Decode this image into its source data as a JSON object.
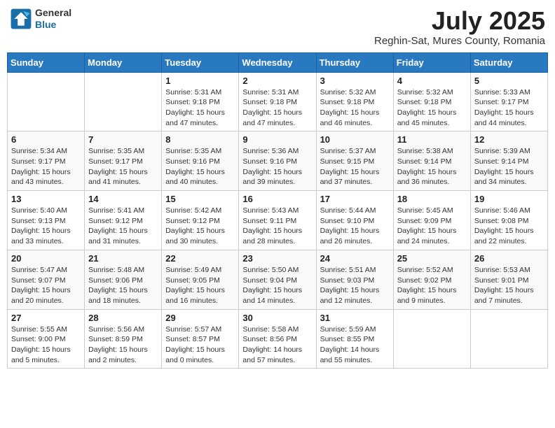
{
  "header": {
    "logo_line1": "General",
    "logo_line2": "Blue",
    "month": "July 2025",
    "location": "Reghin-Sat, Mures County, Romania"
  },
  "weekdays": [
    "Sunday",
    "Monday",
    "Tuesday",
    "Wednesday",
    "Thursday",
    "Friday",
    "Saturday"
  ],
  "weeks": [
    [
      {
        "day": "",
        "sunrise": "",
        "sunset": "",
        "daylight": ""
      },
      {
        "day": "",
        "sunrise": "",
        "sunset": "",
        "daylight": ""
      },
      {
        "day": "1",
        "sunrise": "Sunrise: 5:31 AM",
        "sunset": "Sunset: 9:18 PM",
        "daylight": "Daylight: 15 hours and 47 minutes."
      },
      {
        "day": "2",
        "sunrise": "Sunrise: 5:31 AM",
        "sunset": "Sunset: 9:18 PM",
        "daylight": "Daylight: 15 hours and 47 minutes."
      },
      {
        "day": "3",
        "sunrise": "Sunrise: 5:32 AM",
        "sunset": "Sunset: 9:18 PM",
        "daylight": "Daylight: 15 hours and 46 minutes."
      },
      {
        "day": "4",
        "sunrise": "Sunrise: 5:32 AM",
        "sunset": "Sunset: 9:18 PM",
        "daylight": "Daylight: 15 hours and 45 minutes."
      },
      {
        "day": "5",
        "sunrise": "Sunrise: 5:33 AM",
        "sunset": "Sunset: 9:17 PM",
        "daylight": "Daylight: 15 hours and 44 minutes."
      }
    ],
    [
      {
        "day": "6",
        "sunrise": "Sunrise: 5:34 AM",
        "sunset": "Sunset: 9:17 PM",
        "daylight": "Daylight: 15 hours and 43 minutes."
      },
      {
        "day": "7",
        "sunrise": "Sunrise: 5:35 AM",
        "sunset": "Sunset: 9:17 PM",
        "daylight": "Daylight: 15 hours and 41 minutes."
      },
      {
        "day": "8",
        "sunrise": "Sunrise: 5:35 AM",
        "sunset": "Sunset: 9:16 PM",
        "daylight": "Daylight: 15 hours and 40 minutes."
      },
      {
        "day": "9",
        "sunrise": "Sunrise: 5:36 AM",
        "sunset": "Sunset: 9:16 PM",
        "daylight": "Daylight: 15 hours and 39 minutes."
      },
      {
        "day": "10",
        "sunrise": "Sunrise: 5:37 AM",
        "sunset": "Sunset: 9:15 PM",
        "daylight": "Daylight: 15 hours and 37 minutes."
      },
      {
        "day": "11",
        "sunrise": "Sunrise: 5:38 AM",
        "sunset": "Sunset: 9:14 PM",
        "daylight": "Daylight: 15 hours and 36 minutes."
      },
      {
        "day": "12",
        "sunrise": "Sunrise: 5:39 AM",
        "sunset": "Sunset: 9:14 PM",
        "daylight": "Daylight: 15 hours and 34 minutes."
      }
    ],
    [
      {
        "day": "13",
        "sunrise": "Sunrise: 5:40 AM",
        "sunset": "Sunset: 9:13 PM",
        "daylight": "Daylight: 15 hours and 33 minutes."
      },
      {
        "day": "14",
        "sunrise": "Sunrise: 5:41 AM",
        "sunset": "Sunset: 9:12 PM",
        "daylight": "Daylight: 15 hours and 31 minutes."
      },
      {
        "day": "15",
        "sunrise": "Sunrise: 5:42 AM",
        "sunset": "Sunset: 9:12 PM",
        "daylight": "Daylight: 15 hours and 30 minutes."
      },
      {
        "day": "16",
        "sunrise": "Sunrise: 5:43 AM",
        "sunset": "Sunset: 9:11 PM",
        "daylight": "Daylight: 15 hours and 28 minutes."
      },
      {
        "day": "17",
        "sunrise": "Sunrise: 5:44 AM",
        "sunset": "Sunset: 9:10 PM",
        "daylight": "Daylight: 15 hours and 26 minutes."
      },
      {
        "day": "18",
        "sunrise": "Sunrise: 5:45 AM",
        "sunset": "Sunset: 9:09 PM",
        "daylight": "Daylight: 15 hours and 24 minutes."
      },
      {
        "day": "19",
        "sunrise": "Sunrise: 5:46 AM",
        "sunset": "Sunset: 9:08 PM",
        "daylight": "Daylight: 15 hours and 22 minutes."
      }
    ],
    [
      {
        "day": "20",
        "sunrise": "Sunrise: 5:47 AM",
        "sunset": "Sunset: 9:07 PM",
        "daylight": "Daylight: 15 hours and 20 minutes."
      },
      {
        "day": "21",
        "sunrise": "Sunrise: 5:48 AM",
        "sunset": "Sunset: 9:06 PM",
        "daylight": "Daylight: 15 hours and 18 minutes."
      },
      {
        "day": "22",
        "sunrise": "Sunrise: 5:49 AM",
        "sunset": "Sunset: 9:05 PM",
        "daylight": "Daylight: 15 hours and 16 minutes."
      },
      {
        "day": "23",
        "sunrise": "Sunrise: 5:50 AM",
        "sunset": "Sunset: 9:04 PM",
        "daylight": "Daylight: 15 hours and 14 minutes."
      },
      {
        "day": "24",
        "sunrise": "Sunrise: 5:51 AM",
        "sunset": "Sunset: 9:03 PM",
        "daylight": "Daylight: 15 hours and 12 minutes."
      },
      {
        "day": "25",
        "sunrise": "Sunrise: 5:52 AM",
        "sunset": "Sunset: 9:02 PM",
        "daylight": "Daylight: 15 hours and 9 minutes."
      },
      {
        "day": "26",
        "sunrise": "Sunrise: 5:53 AM",
        "sunset": "Sunset: 9:01 PM",
        "daylight": "Daylight: 15 hours and 7 minutes."
      }
    ],
    [
      {
        "day": "27",
        "sunrise": "Sunrise: 5:55 AM",
        "sunset": "Sunset: 9:00 PM",
        "daylight": "Daylight: 15 hours and 5 minutes."
      },
      {
        "day": "28",
        "sunrise": "Sunrise: 5:56 AM",
        "sunset": "Sunset: 8:59 PM",
        "daylight": "Daylight: 15 hours and 2 minutes."
      },
      {
        "day": "29",
        "sunrise": "Sunrise: 5:57 AM",
        "sunset": "Sunset: 8:57 PM",
        "daylight": "Daylight: 15 hours and 0 minutes."
      },
      {
        "day": "30",
        "sunrise": "Sunrise: 5:58 AM",
        "sunset": "Sunset: 8:56 PM",
        "daylight": "Daylight: 14 hours and 57 minutes."
      },
      {
        "day": "31",
        "sunrise": "Sunrise: 5:59 AM",
        "sunset": "Sunset: 8:55 PM",
        "daylight": "Daylight: 14 hours and 55 minutes."
      },
      {
        "day": "",
        "sunrise": "",
        "sunset": "",
        "daylight": ""
      },
      {
        "day": "",
        "sunrise": "",
        "sunset": "",
        "daylight": ""
      }
    ]
  ]
}
